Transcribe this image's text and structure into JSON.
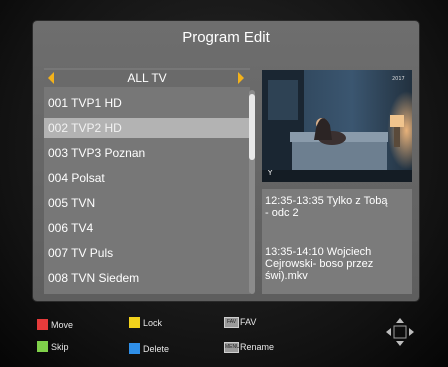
{
  "window": {
    "title": "Program Edit"
  },
  "group": {
    "label": "ALL TV"
  },
  "channels": [
    {
      "label": "001 TVP1 HD",
      "selected": false
    },
    {
      "label": "002 TVP2 HD",
      "selected": true
    },
    {
      "label": "003 TVP3 Poznan",
      "selected": false
    },
    {
      "label": "004 Polsat",
      "selected": false
    },
    {
      "label": "005 TVN",
      "selected": false
    },
    {
      "label": "006 TV4",
      "selected": false
    },
    {
      "label": "007 TV Puls",
      "selected": false
    },
    {
      "label": "008 TVN Siedem",
      "selected": false
    }
  ],
  "epg": {
    "current_line1": "12:35-13:35  Tylko z Tobą",
    "current_line2": "- odc 2",
    "next_line1": "13:35-14:10  Wojciech",
    "next_line2": "Cejrowski- boso przez",
    "next_line3": "świ).mkv"
  },
  "help": {
    "move": "Move",
    "lock": "Lock",
    "fav": "FAV",
    "fav_key": "FAV",
    "skip": "Skip",
    "delete": "Delete",
    "rename": "Rename",
    "rename_key": "MENU"
  },
  "colors": {
    "red": "#e53b3b",
    "yellow": "#f2d21c",
    "green": "#7fd04a",
    "blue": "#2f8fe8",
    "accent_arrow": "#f3b21b"
  }
}
